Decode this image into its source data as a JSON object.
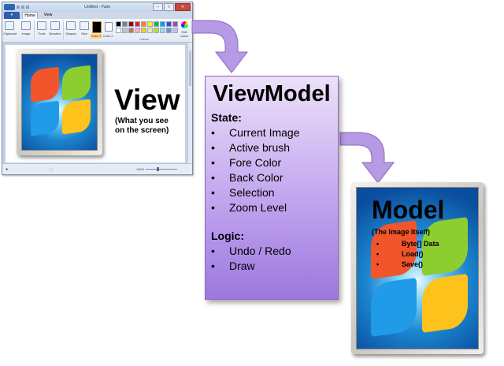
{
  "paint": {
    "title": "Untitled - Paint",
    "tab_home": "Home",
    "tab_view": "View",
    "tools": {
      "clipboard": "Clipboard",
      "image": "Image",
      "tools": "Tools",
      "brushes": "Brushes",
      "shapes": "Shapes",
      "size": "Size",
      "color1": "Color 1",
      "color2": "Color 2",
      "edit_colors": "Edit colors"
    },
    "colors_group": "Colors",
    "zoom": "100%",
    "palette": [
      "#000000",
      "#7f7f7f",
      "#880015",
      "#ed1c24",
      "#ff7f27",
      "#fff200",
      "#22b14c",
      "#00a2e8",
      "#3f48cc",
      "#a349a4",
      "#ffffff",
      "#c3c3c3",
      "#b97a57",
      "#ffaec9",
      "#ffc90e",
      "#efe4b0",
      "#b5e61d",
      "#99d9ea",
      "#7092be",
      "#c8bfe7"
    ]
  },
  "view": {
    "title": "View",
    "subtitle_line1": "(What you see",
    "subtitle_line2": "on the screen)"
  },
  "viewmodel": {
    "title": "ViewModel",
    "state_heading": "State:",
    "state_items": [
      "Current Image",
      "Active brush",
      "Fore Color",
      "Back Color",
      "Selection",
      "Zoom Level"
    ],
    "logic_heading": "Logic:",
    "logic_items": [
      "Undo / Redo",
      "Draw"
    ]
  },
  "model": {
    "title": "Model",
    "subtitle": "(The Image itself)",
    "items": [
      "Byte[] Data",
      "Load()",
      "Save()"
    ]
  },
  "colors": {
    "arrow_fill": "#b79ae6",
    "arrow_stroke": "#8a6ab8"
  }
}
